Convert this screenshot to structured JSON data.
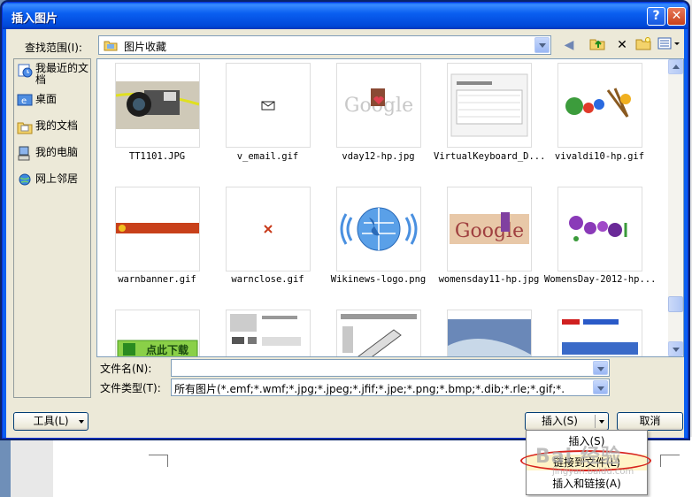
{
  "window": {
    "title": "插入图片"
  },
  "lookin": {
    "label": "查找范围(I):",
    "value": "图片收藏"
  },
  "places": [
    {
      "label": "我最近的文档"
    },
    {
      "label": "桌面"
    },
    {
      "label": "我的文档"
    },
    {
      "label": "我的电脑"
    },
    {
      "label": "网上邻居"
    }
  ],
  "files": [
    {
      "name": "TT1101.JPG"
    },
    {
      "name": "v_email.gif"
    },
    {
      "name": "vday12-hp.jpg"
    },
    {
      "name": "VirtualKeyboard_D..."
    },
    {
      "name": "vivaldi10-hp.gif"
    },
    {
      "name": "warnbanner.gif"
    },
    {
      "name": "warnclose.gif"
    },
    {
      "name": "Wikinews-logo.png"
    },
    {
      "name": "womensday11-hp.jpg"
    },
    {
      "name": "WomensDay-2012-hp..."
    }
  ],
  "thumb_text": {
    "google": "Google",
    "download": "点此下载"
  },
  "filename": {
    "label": "文件名(N):",
    "value": ""
  },
  "filetype": {
    "label": "文件类型(T):",
    "value": "所有图片(*.emf;*.wmf;*.jpg;*.jpeg;*.jfif;*.jpe;*.png;*.bmp;*.dib;*.rle;*.gif;*."
  },
  "buttons": {
    "tools": "工具(L)",
    "insert": "插入(S)",
    "cancel": "取消"
  },
  "insert_menu": [
    {
      "label": "插入(S)"
    },
    {
      "label": "链接到文件(L)"
    },
    {
      "label": "插入和链接(A)"
    }
  ],
  "watermark": {
    "text": "Bai 经验",
    "sub": "jingyan.baidu.com"
  },
  "colors": {
    "title_bar": "#0a5ff1",
    "dialog_bg": "#ece9d8",
    "annotation": "#d8241c"
  }
}
